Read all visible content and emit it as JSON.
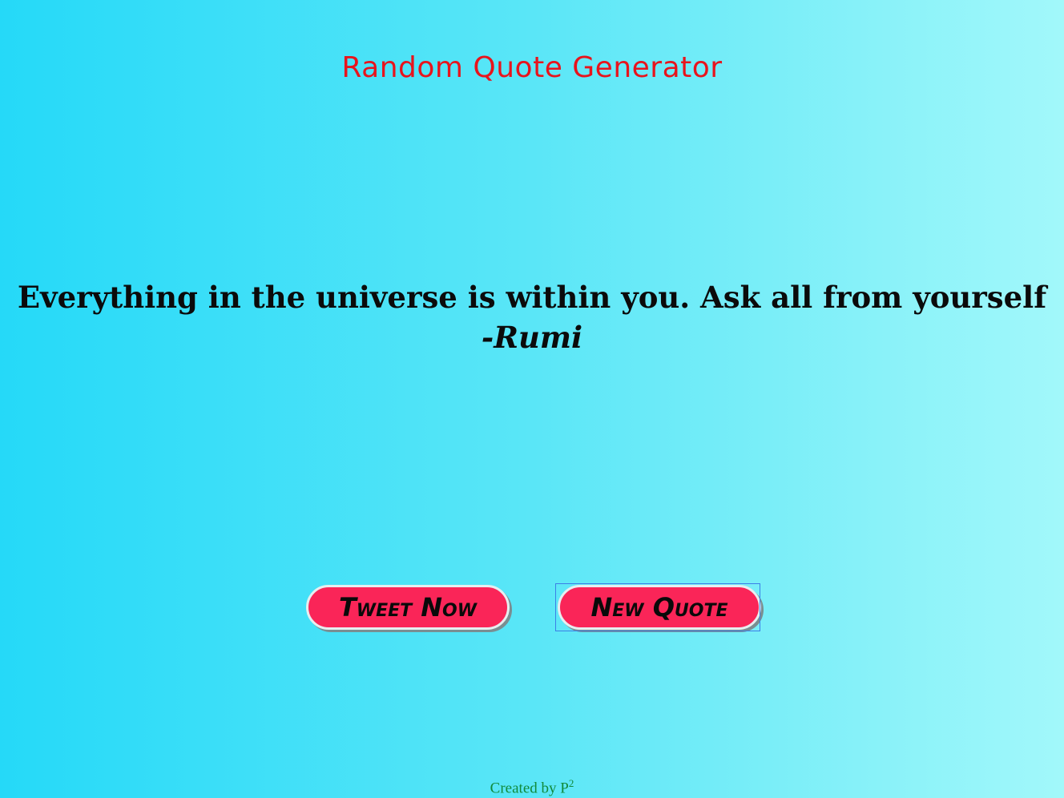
{
  "header": {
    "title": "Random Quote Generator"
  },
  "quote": {
    "text": "Everything in the universe is within you. Ask all from yourself",
    "author": "-Rumi"
  },
  "buttons": {
    "tweet_label": "Tweet Now",
    "new_quote_label": "New Quote"
  },
  "footer": {
    "credit_text": "Created by P",
    "credit_superscript": "2"
  },
  "colors": {
    "title": "#e8141c",
    "button_bg": "#fa2558",
    "footer": "#118a3a",
    "gradient_start": "#25d9f8",
    "gradient_end": "#a2f8fa"
  }
}
